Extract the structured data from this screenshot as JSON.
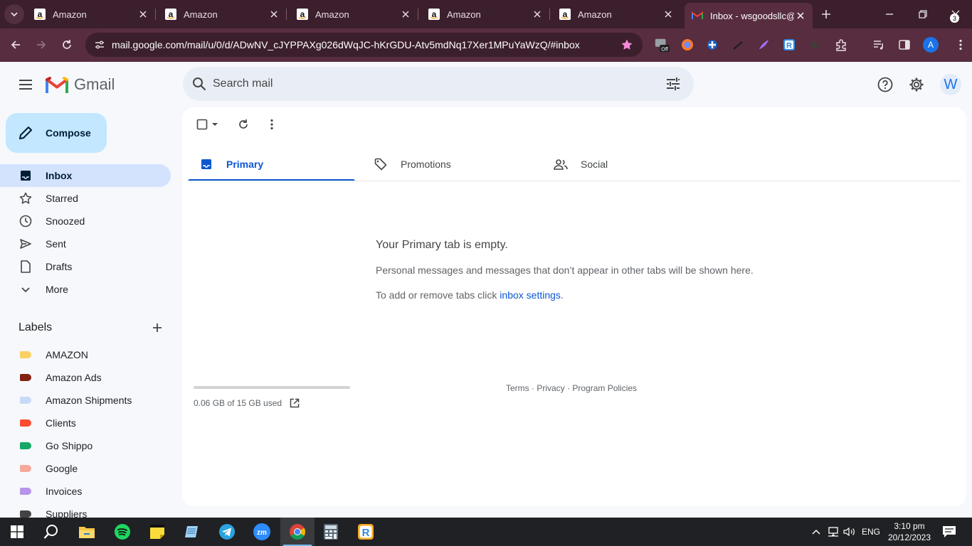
{
  "browser": {
    "tabs": [
      {
        "title": "Amazon",
        "favicon": "amazon-icon",
        "active": false
      },
      {
        "title": "Amazon",
        "favicon": "amazon-icon",
        "active": false
      },
      {
        "title": "Amazon",
        "favicon": "amazon-icon",
        "active": false
      },
      {
        "title": "Amazon",
        "favicon": "amazon-icon",
        "active": false
      },
      {
        "title": "Amazon",
        "favicon": "amazon-icon",
        "active": false
      },
      {
        "title": "Inbox - wsgoodsllc@",
        "favicon": "gmail-icon",
        "active": true
      }
    ],
    "url": "mail.google.com/mail/u/0/d/ADwNV_cJYPPAXg026dWqJC-hKrGDU-Atv5mdNq17Xer1MPuYaWzQ/#inbox",
    "extension_badge": "Off",
    "profile_initial": "A",
    "colors": {
      "frame": "#3c1f2d",
      "toolbar": "#572d3f"
    }
  },
  "gmail": {
    "app_name": "Gmail",
    "search_placeholder": "Search mail",
    "account_initial": "W",
    "compose_label": "Compose",
    "nav": [
      {
        "label": "Inbox",
        "icon": "inbox-icon",
        "selected": true
      },
      {
        "label": "Starred",
        "icon": "star-icon",
        "selected": false
      },
      {
        "label": "Snoozed",
        "icon": "clock-icon",
        "selected": false
      },
      {
        "label": "Sent",
        "icon": "send-icon",
        "selected": false
      },
      {
        "label": "Drafts",
        "icon": "draft-icon",
        "selected": false
      },
      {
        "label": "More",
        "icon": "chevron-down-icon",
        "selected": false
      }
    ],
    "labels_heading": "Labels",
    "labels": [
      {
        "name": "AMAZON",
        "color": "#fad165"
      },
      {
        "name": "Amazon Ads",
        "color": "#822111"
      },
      {
        "name": "Amazon Shipments",
        "color": "#c9daf8"
      },
      {
        "name": "Clients",
        "color": "#fb4c2f"
      },
      {
        "name": "Go Shippo",
        "color": "#16a766"
      },
      {
        "name": "Google",
        "color": "#f6a99a"
      },
      {
        "name": "Invoices",
        "color": "#b694e8"
      },
      {
        "name": "Suppliers",
        "color": "#434343"
      }
    ],
    "category_tabs": [
      {
        "label": "Primary",
        "icon": "inbox-icon",
        "active": true
      },
      {
        "label": "Promotions",
        "icon": "tag-icon",
        "active": false
      },
      {
        "label": "Social",
        "icon": "people-icon",
        "active": false
      }
    ],
    "empty_state": {
      "title": "Your Primary tab is empty.",
      "description": "Personal messages and messages that don’t appear in other tabs will be shown here.",
      "hint_prefix": "To add or remove tabs click ",
      "hint_link": "inbox settings",
      "hint_suffix": "."
    },
    "storage": {
      "text": "0.06 GB of 15 GB used",
      "used_fraction": 0.004
    },
    "footer": {
      "terms": "Terms",
      "privacy": "Privacy",
      "policies": "Program Policies",
      "separator": " · "
    },
    "accent_color": "#0b57d0"
  },
  "taskbar": {
    "apps": [
      "windows-start-icon",
      "search-icon",
      "file-explorer-icon",
      "spotify-icon",
      "sticky-notes-icon",
      "notepad-icon",
      "telegram-icon",
      "zoom-icon",
      "chrome-icon",
      "calculator-icon",
      "app-r-icon"
    ],
    "language": "ENG",
    "time": "3:10 pm",
    "date": "20/12/2023",
    "notification_count": "3"
  }
}
